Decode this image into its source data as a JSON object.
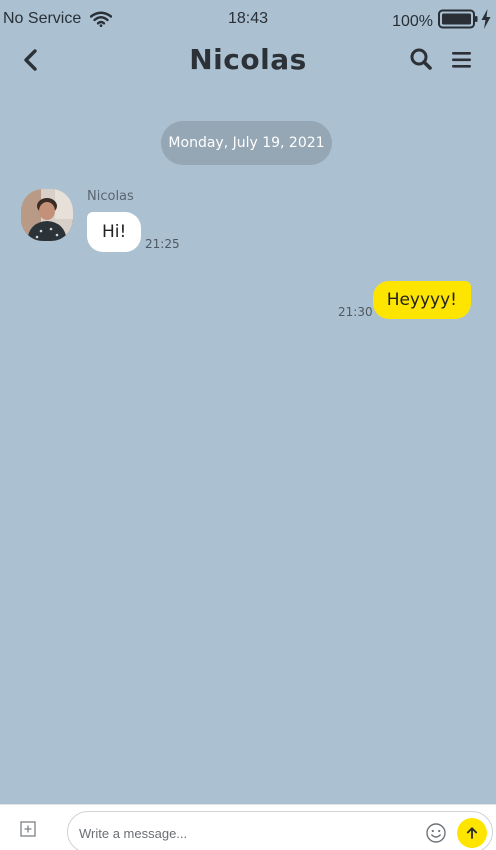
{
  "status_bar": {
    "carrier": "No Service",
    "time": "18:43",
    "battery": "100%",
    "icons": [
      "wifi-icon",
      "battery-icon",
      "charging-bolt-icon"
    ]
  },
  "header": {
    "title": "Nicolas",
    "icons": [
      "back-chevron-icon",
      "search-icon",
      "hamburger-menu-icon"
    ]
  },
  "conversation": {
    "date_divider": "Monday, July 19, 2021",
    "messages": [
      {
        "direction": "incoming",
        "sender": "Nicolas",
        "text": "Hi!",
        "time": "21:25"
      },
      {
        "direction": "outgoing",
        "text": "Heyyyy!",
        "time": "21:30"
      }
    ]
  },
  "composer": {
    "placeholder": "Write a message...",
    "icons": [
      "add-attachment-icon",
      "emoji-icon",
      "send-arrow-icon"
    ]
  },
  "colors": {
    "background": "#abc1d1",
    "outgoing_bubble": "#fee500",
    "incoming_bubble": "#ffffff",
    "date_pill": "#95a6b4",
    "send_button": "#fee500"
  }
}
